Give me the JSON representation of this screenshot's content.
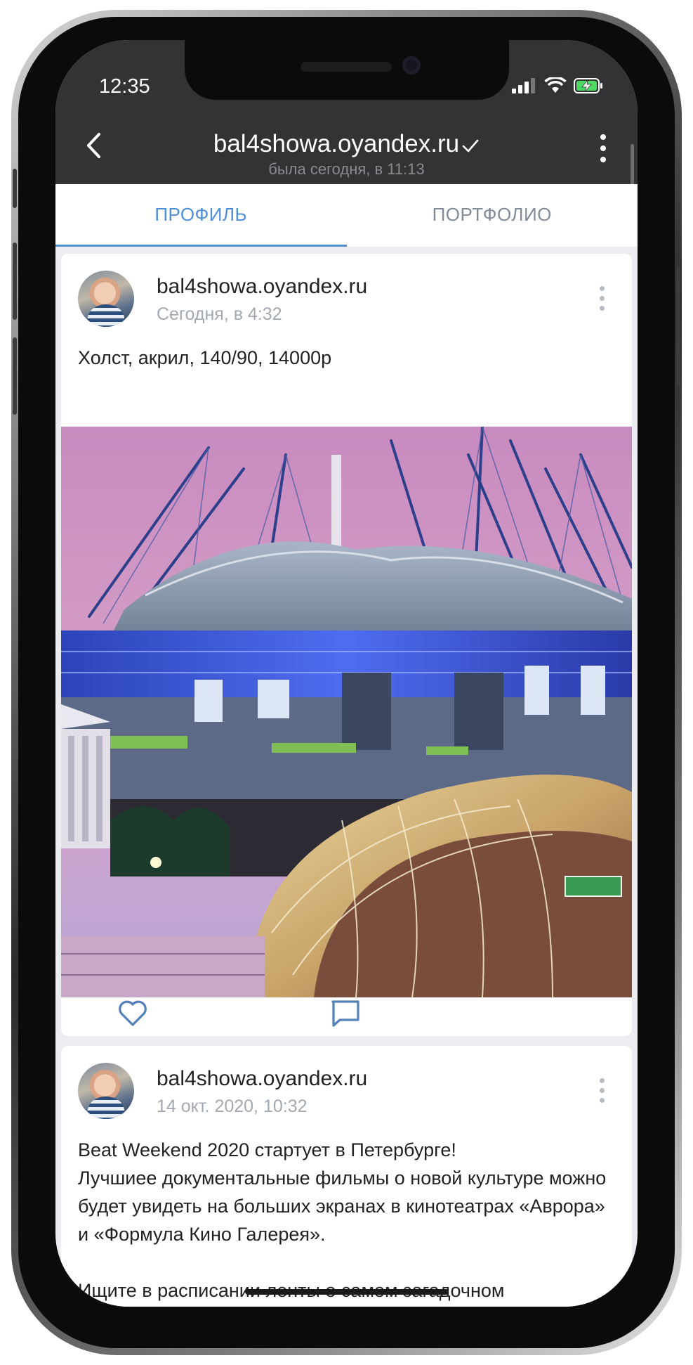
{
  "status_bar": {
    "time": "12:35"
  },
  "header": {
    "title": "bal4showa.oyandex.ru",
    "subtitle": "была сегодня, в 11:13"
  },
  "tabs": [
    {
      "label": "ПРОФИЛЬ",
      "active": true
    },
    {
      "label": "ПОРТФОЛИО",
      "active": false
    }
  ],
  "posts": [
    {
      "author": "bal4showa.oyandex.ru",
      "time": "Сегодня, в 4:32",
      "text": "Холст, акрил, 140/90, 14000р",
      "image": "painting-stadium"
    },
    {
      "author": "bal4showa.oyandex.ru",
      "time": "14 окт. 2020, 10:32",
      "text": "Beat Weekend 2020 стартует в Петербурге!\n  Лучшиее документальные фильмы о новой культуре можно будет увидеть на больших экранах в кинотеатрах «Аврора» и «Формула Кино Галерея».\n\nИщите в расписании ленты о самом загадочном"
    }
  ],
  "colors": {
    "header_bg": "#333336",
    "accent": "#4f8fd6",
    "feed_bg": "#ebedf0",
    "icon": "#5181b8"
  }
}
